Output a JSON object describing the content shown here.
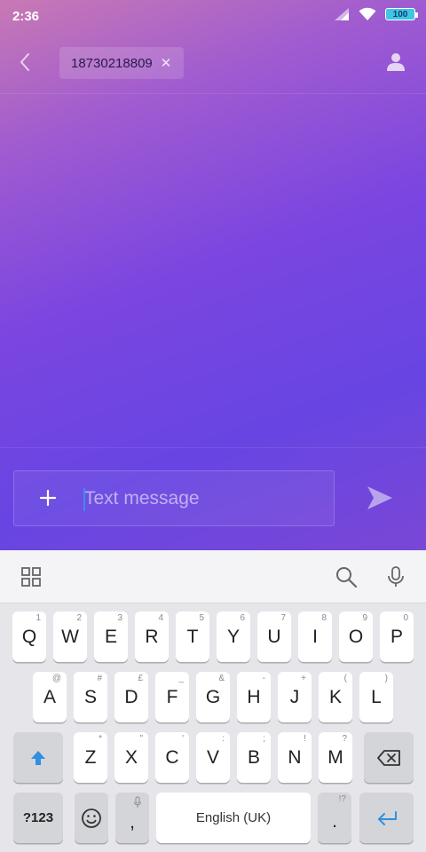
{
  "status_bar": {
    "time": "2:36",
    "battery_level": "100"
  },
  "conversation": {
    "recipient": "18730218809"
  },
  "composer": {
    "placeholder": "Text message",
    "value": ""
  },
  "keyboard": {
    "row1": [
      {
        "label": "Q",
        "hint": "1"
      },
      {
        "label": "W",
        "hint": "2"
      },
      {
        "label": "E",
        "hint": "3"
      },
      {
        "label": "R",
        "hint": "4"
      },
      {
        "label": "T",
        "hint": "5"
      },
      {
        "label": "Y",
        "hint": "6"
      },
      {
        "label": "U",
        "hint": "7"
      },
      {
        "label": "I",
        "hint": "8"
      },
      {
        "label": "O",
        "hint": "9"
      },
      {
        "label": "P",
        "hint": "0"
      }
    ],
    "row2": [
      {
        "label": "A",
        "hint": "@"
      },
      {
        "label": "S",
        "hint": "#"
      },
      {
        "label": "D",
        "hint": "£"
      },
      {
        "label": "F",
        "hint": "_"
      },
      {
        "label": "G",
        "hint": "&"
      },
      {
        "label": "H",
        "hint": "-"
      },
      {
        "label": "J",
        "hint": "+"
      },
      {
        "label": "K",
        "hint": "("
      },
      {
        "label": "L",
        "hint": ")"
      }
    ],
    "row3": [
      {
        "label": "Z",
        "hint": "*"
      },
      {
        "label": "X",
        "hint": "\""
      },
      {
        "label": "C",
        "hint": "'"
      },
      {
        "label": "V",
        "hint": ":"
      },
      {
        "label": "B",
        "hint": ";"
      },
      {
        "label": "N",
        "hint": "!"
      },
      {
        "label": "M",
        "hint": "?"
      }
    ],
    "symbols_label": "?123",
    "comma_label": ",",
    "space_label": "English (UK)",
    "period_label": ".",
    "period_hint": "!?"
  },
  "colors": {
    "accent_blue": "#3a8cf0",
    "gradient_start": "#c879b4",
    "gradient_end": "#6745e2"
  }
}
